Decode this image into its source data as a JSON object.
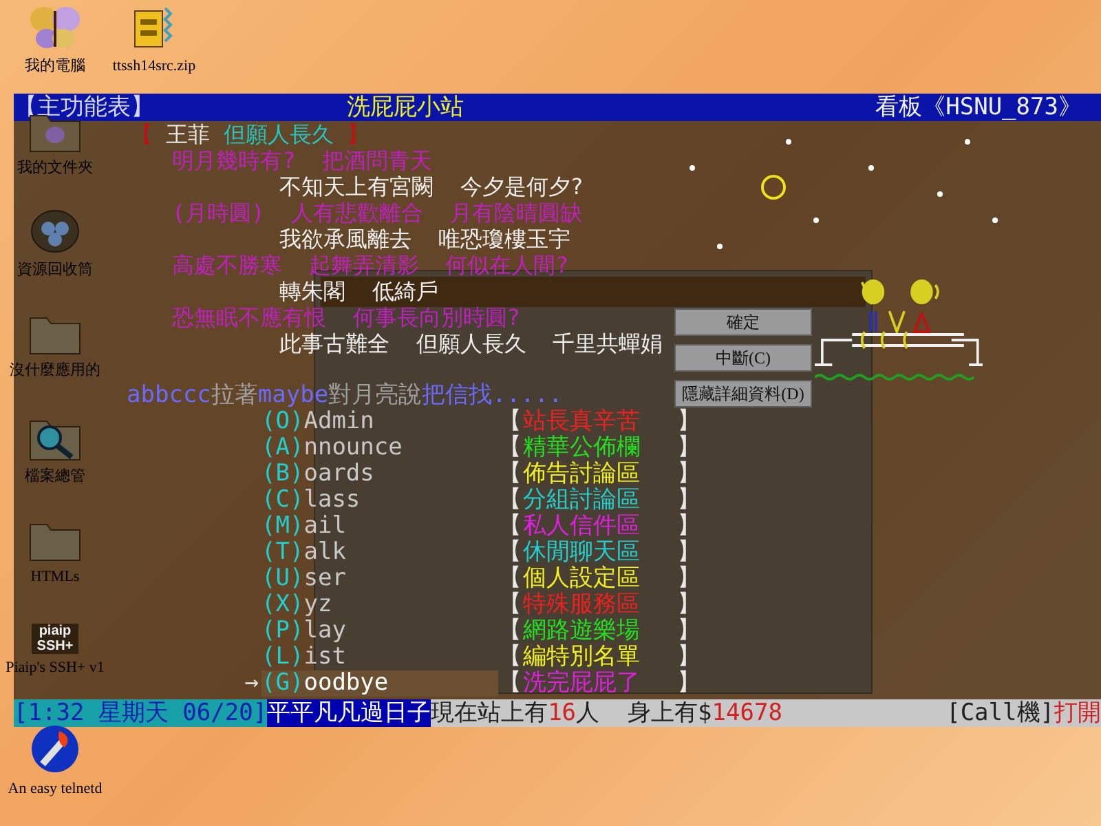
{
  "desktop_icons": [
    {
      "kind": "computer",
      "label": "我的電腦"
    },
    {
      "kind": "archive",
      "label": "ttssh14src.zip"
    },
    {
      "kind": "documents",
      "label": "我的文件夾"
    },
    {
      "kind": "recycle",
      "label": "資源回收筒"
    },
    {
      "kind": "folder",
      "label": "沒什麼應用的"
    },
    {
      "kind": "explorer",
      "label": "檔案總管"
    },
    {
      "kind": "folder",
      "label": "HTMLs"
    },
    {
      "kind": "app",
      "label": "Piaip's SSH+ v1",
      "logo_lines": [
        "piaip",
        "SSH+"
      ]
    },
    {
      "kind": "telnet",
      "label": "An easy telnetd"
    }
  ],
  "dialog": {
    "buttons": [
      {
        "label": "確定"
      },
      {
        "label": "中斷(C)"
      },
      {
        "label": "隱藏詳細資料(D)"
      }
    ]
  },
  "terminal": {
    "header": {
      "left": "【主功能表】",
      "center": "洗屁屁小站",
      "right": "看板《HSNU_873》"
    },
    "poem": [
      {
        "kind": "title",
        "segments": [
          {
            "text": "【",
            "color": "#c01010"
          },
          {
            "text": " 王菲 ",
            "color": "#e8e8e8"
          },
          {
            "text": "但願人長久",
            "color": "#20c8c8"
          },
          {
            "text": " 】",
            "color": "#c01010"
          }
        ]
      },
      {
        "kind": "verse",
        "segments": [
          {
            "text": "明月幾時有?  把酒問青天",
            "color": "#c020c0"
          }
        ]
      },
      {
        "kind": "reply",
        "segments": [
          {
            "text": "不知天上有宮闕  今夕是何夕?",
            "color": "#f0f0f0"
          }
        ]
      },
      {
        "kind": "verse",
        "segments": [
          {
            "text": "(月時圓)  人有悲歡離合  月有陰晴圓缺",
            "color": "#c020c0"
          }
        ]
      },
      {
        "kind": "reply",
        "segments": [
          {
            "text": "我欲承風離去  唯恐瓊樓玉宇",
            "color": "#f0f0f0"
          }
        ]
      },
      {
        "kind": "verse",
        "segments": [
          {
            "text": "高處不勝寒  起舞弄清影  何似在人間?",
            "color": "#c020c0"
          }
        ]
      },
      {
        "kind": "reply",
        "segments": [
          {
            "text": "轉朱閣  低綺戶",
            "color": "#f0f0f0"
          }
        ]
      },
      {
        "kind": "verse",
        "segments": [
          {
            "text": "恐無眠不應有恨  何事長向別時圓?",
            "color": "#c020c0"
          }
        ]
      },
      {
        "kind": "reply",
        "segments": [
          {
            "text": "此事古難全  但願人長久  千里共蟬娟",
            "color": "#f0f0f0"
          }
        ]
      }
    ],
    "marquee": [
      {
        "text": "abbccc",
        "color": "#6a6aff"
      },
      {
        "text": "拉著",
        "color": "#a0a0a0"
      },
      {
        "text": "maybe",
        "color": "#6a6aff"
      },
      {
        "text": "對月亮說",
        "color": "#a0a0a0"
      },
      {
        "text": "把信找.....",
        "color": "#6a6aff"
      }
    ],
    "cursor": "→",
    "menu": [
      {
        "hotkey": "(O)",
        "name": "Admin",
        "open": "【",
        "label": "站長真辛苦",
        "close": "】",
        "color": "#f02020",
        "selected": false
      },
      {
        "hotkey": "(A)",
        "name": "nnounce",
        "open": "【",
        "label": "精華公佈欄",
        "close": "】",
        "color": "#20e020",
        "selected": false
      },
      {
        "hotkey": "(B)",
        "name": "oards",
        "open": "【",
        "label": "佈告討論區",
        "close": "】",
        "color": "#f0f020",
        "selected": false
      },
      {
        "hotkey": "(C)",
        "name": "lass",
        "open": "【",
        "label": "分組討論區",
        "close": "】",
        "color": "#20d0d0",
        "selected": false
      },
      {
        "hotkey": "(M)",
        "name": "ail",
        "open": "【",
        "label": "私人信件區",
        "close": "】",
        "color": "#e020e0",
        "selected": false
      },
      {
        "hotkey": "(T)",
        "name": "alk",
        "open": "【",
        "label": "休閒聊天區",
        "close": "】",
        "color": "#20d0d0",
        "selected": false
      },
      {
        "hotkey": "(U)",
        "name": "ser",
        "open": "【",
        "label": "個人設定區",
        "close": "】",
        "color": "#f0f020",
        "selected": false
      },
      {
        "hotkey": "(X)",
        "name": "yz",
        "open": "【",
        "label": "特殊服務區",
        "close": "】",
        "color": "#f02020",
        "selected": false
      },
      {
        "hotkey": "(P)",
        "name": "lay",
        "open": "【",
        "label": "網路遊樂場",
        "close": "】",
        "color": "#20e020",
        "selected": false
      },
      {
        "hotkey": "(L)",
        "name": "ist",
        "open": "【",
        "label": "編特別名單",
        "close": "】",
        "color": "#f0f020",
        "selected": false
      },
      {
        "hotkey": "(G)",
        "name": "oodbye",
        "open": "【",
        "label": "洗完屁屁了",
        "close": "】",
        "color": "#e020e0",
        "selected": true
      }
    ],
    "status_bar": [
      {
        "kind": "clock",
        "text": "[1:32 星期天 06/20]"
      },
      {
        "kind": "motto",
        "text": "平平凡凡過日子"
      },
      {
        "kind": "plain",
        "text": "現在站上有"
      },
      {
        "kind": "alert",
        "text": "16"
      },
      {
        "kind": "plain",
        "text": "人  身上有$"
      },
      {
        "kind": "alert",
        "text": "14678"
      },
      {
        "kind": "right",
        "text": "[Call機]"
      },
      {
        "kind": "alert",
        "text": "打開"
      }
    ]
  }
}
